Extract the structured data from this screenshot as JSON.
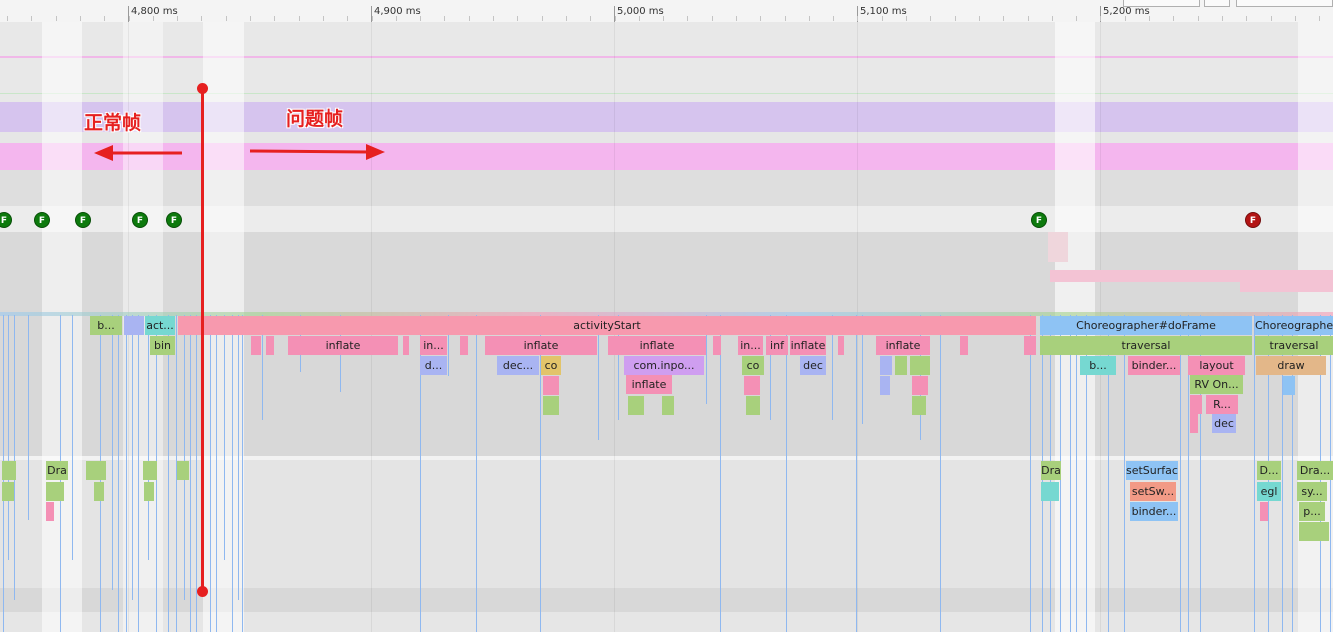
{
  "ruler": {
    "ticks": [
      "4,800 ms",
      "4,900 ms",
      "5,000 ms",
      "5,100 ms",
      "5,200 ms"
    ]
  },
  "annotations": {
    "normal_frames": "正常帧",
    "problem_frames": "问题帧"
  },
  "frames": [
    {
      "label": "F",
      "status": "good"
    },
    {
      "label": "F",
      "status": "good"
    },
    {
      "label": "F",
      "status": "good"
    },
    {
      "label": "F",
      "status": "good"
    },
    {
      "label": "F",
      "status": "good"
    },
    {
      "label": "F",
      "status": "good"
    },
    {
      "label": "F",
      "status": "jank"
    }
  ],
  "colors": {
    "good_frame": "#0d7a0d",
    "jank_frame": "#b31414",
    "annotation": "#e62020",
    "inflate": "#f490b5",
    "activity_start": "#f799ae",
    "choreographer": "#8ec3f4",
    "traversal": "#a8d07c"
  },
  "ui_thread": {
    "row0": [
      "b...",
      "act...",
      "activityStart",
      "Choreographer#doFrame",
      "Choreographe"
    ],
    "row1": [
      "bin",
      "inflate",
      "in...",
      "inflate",
      "inflate",
      "in...",
      "inf",
      "inflate",
      "inflate",
      "traversal",
      "traversal"
    ],
    "row2": [
      "d...",
      "dec...",
      "co",
      "com.inpo...",
      "co",
      "dec",
      "b...",
      "binder...",
      "layout",
      "draw"
    ],
    "row3": [
      "inflate",
      "RV On..."
    ],
    "row4": [
      "R..."
    ],
    "row5": [
      "dec"
    ]
  },
  "render_thread": {
    "row0": [
      "Dra",
      "Dra",
      "setSurface",
      "D...",
      "Dra..."
    ],
    "row1": [
      "setSw...",
      "egl",
      "sy..."
    ],
    "row2": [
      "binder...",
      "p..."
    ]
  }
}
